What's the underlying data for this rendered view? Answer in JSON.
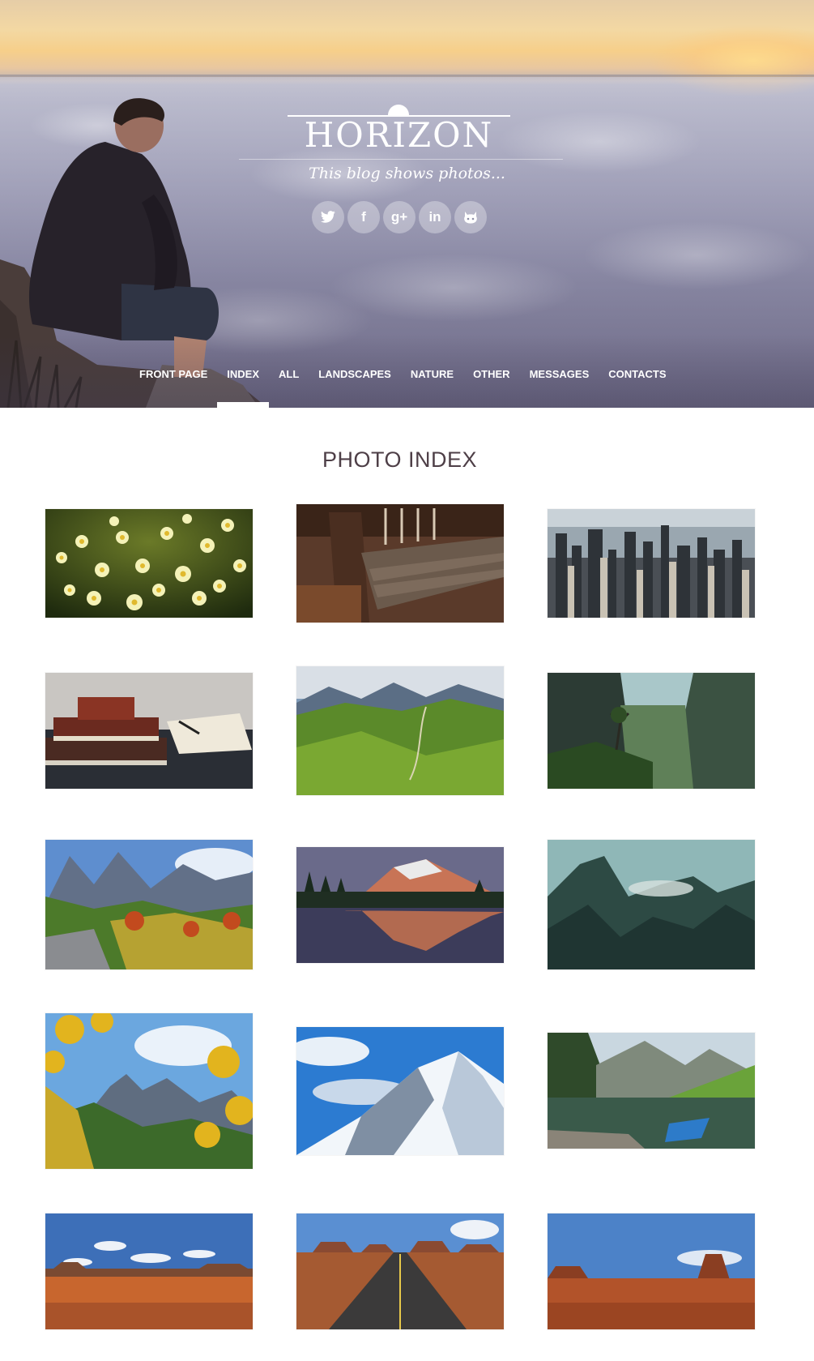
{
  "site": {
    "logo": "HORIZON",
    "tagline": "This blog shows photos..."
  },
  "social": [
    {
      "name": "twitter",
      "glyph": "🐦"
    },
    {
      "name": "facebook",
      "glyph": "f"
    },
    {
      "name": "google-plus",
      "glyph": "g+"
    },
    {
      "name": "linkedin",
      "glyph": "in"
    },
    {
      "name": "github",
      "glyph": "☻"
    }
  ],
  "nav": {
    "active": "INDEX",
    "items": [
      "FRONT PAGE",
      "INDEX",
      "ALL",
      "LANDSCAPES",
      "NATURE",
      "OTHER",
      "MESSAGES",
      "CONTACTS"
    ]
  },
  "index": {
    "title": "PHOTO INDEX",
    "photos": [
      {
        "subject": "daisy flowers"
      },
      {
        "subject": "wooden bench"
      },
      {
        "subject": "city skyline"
      },
      {
        "subject": "books and notebook"
      },
      {
        "subject": "green mountain valley"
      },
      {
        "subject": "tree on cliff valley"
      },
      {
        "subject": "autumn mountains and creek"
      },
      {
        "subject": "mountain lake reflection"
      },
      {
        "subject": "misty mountains"
      },
      {
        "subject": "autumn leaves and mountains"
      },
      {
        "subject": "snowy mountain"
      },
      {
        "subject": "lake with blue boat"
      },
      {
        "subject": "desert plateau"
      },
      {
        "subject": "desert road"
      },
      {
        "subject": "monument valley"
      }
    ]
  }
}
